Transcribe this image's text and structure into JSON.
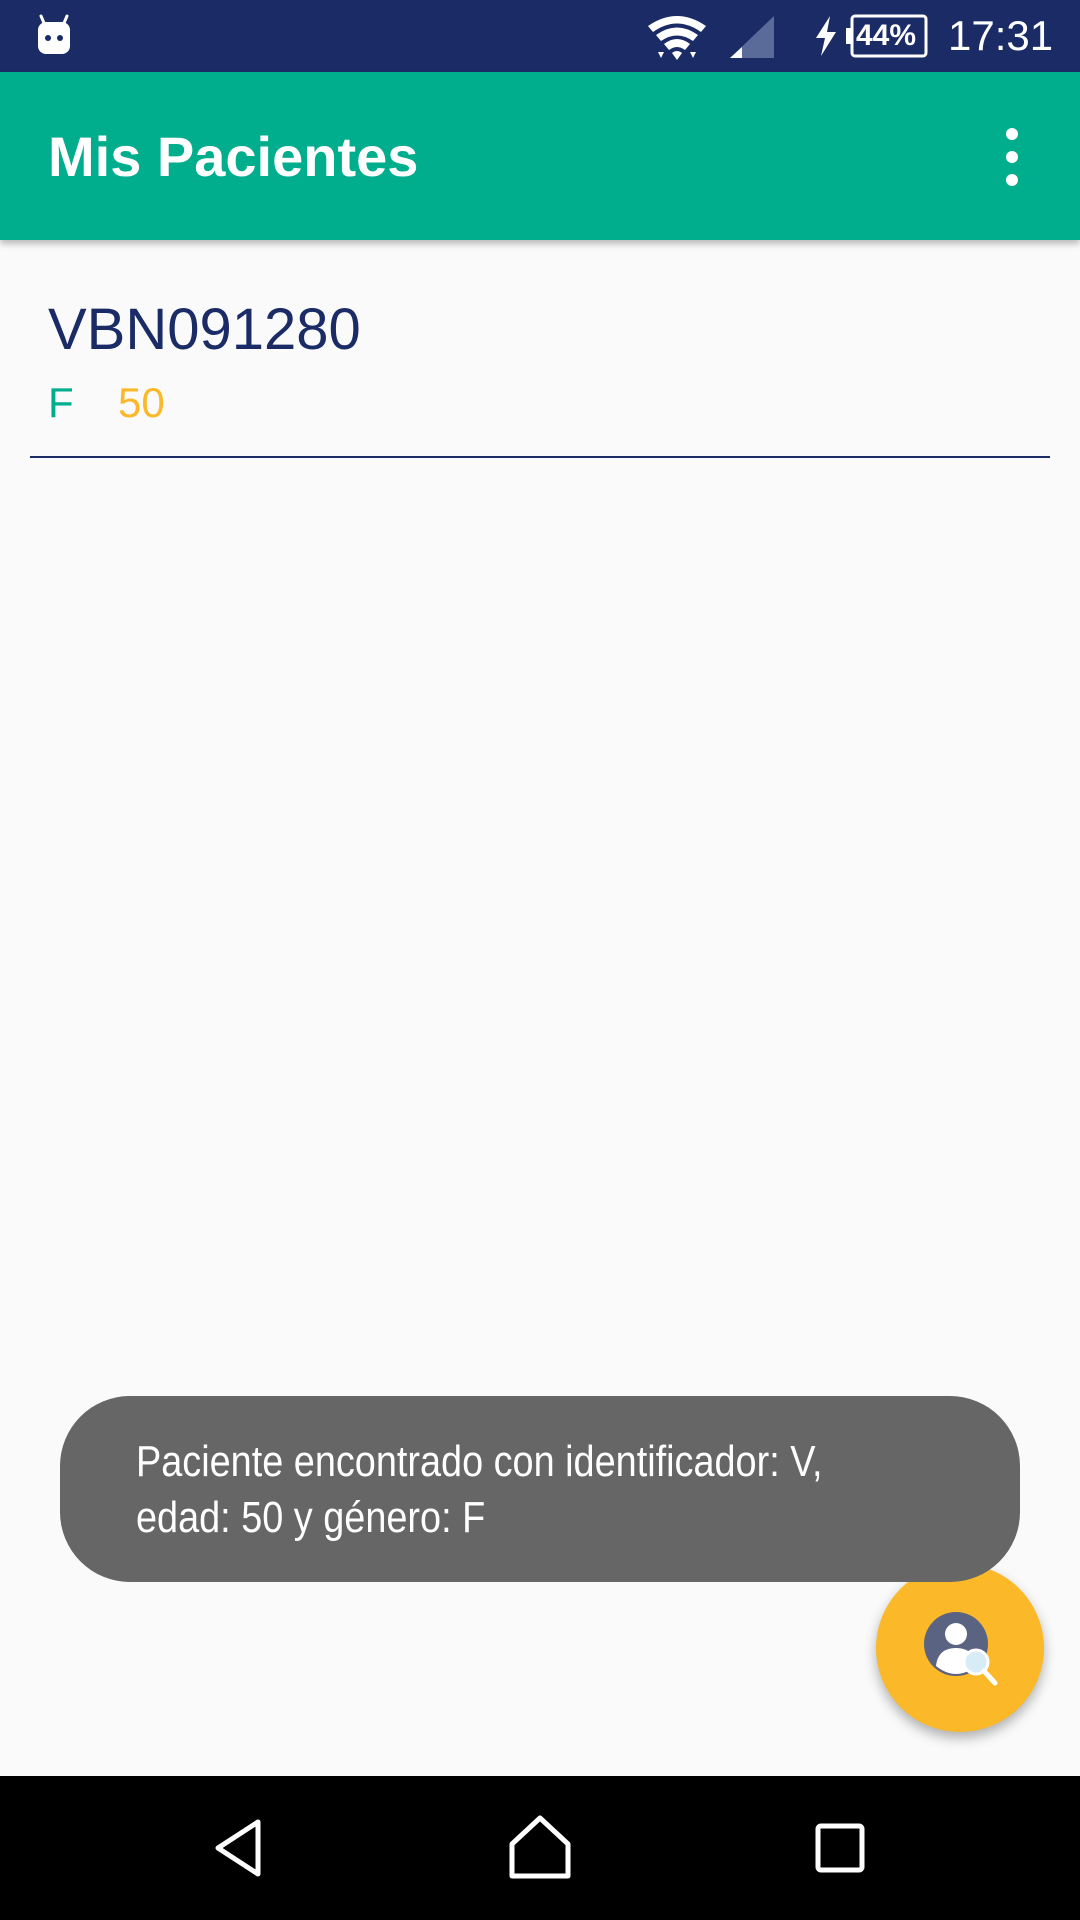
{
  "status_bar": {
    "battery_label": "44%",
    "clock": "17:31",
    "icons": [
      "android-notification-icon",
      "wifi-icon",
      "cell-signal-icon",
      "charging-icon",
      "battery-icon"
    ]
  },
  "app_bar": {
    "title": "Mis Pacientes",
    "menu_icon": "overflow-menu-icon"
  },
  "patients": [
    {
      "id": "VBN091280",
      "gender": "F",
      "age": "50"
    }
  ],
  "toast": {
    "line1": "Paciente encontrado con identificador: V,",
    "line2": "edad: 50 y género: F"
  },
  "fab": {
    "icon": "patient-search-icon"
  },
  "nav_bar": {
    "icons": [
      "back-icon",
      "home-icon",
      "recents-icon"
    ]
  },
  "colors": {
    "status_bar": "#1a2b66",
    "app_bar": "#00ad8c",
    "primary_dark_text": "#1a2b66",
    "gender_text": "#00ad8c",
    "age_text": "#fbb829",
    "fab": "#fbb829",
    "toast_bg": "#666666"
  }
}
